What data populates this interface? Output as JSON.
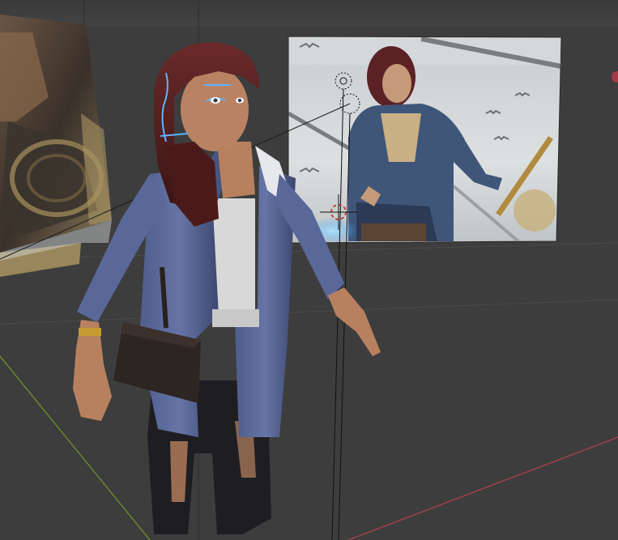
{
  "viewport": {
    "mode": "3D Viewport",
    "background": "#3d3d3d",
    "header_band": "#3a3a3a"
  },
  "axes": {
    "x_axis_color": "#a4404a",
    "y_axis_color": "#6e8a2f"
  },
  "objects": [
    {
      "name": "reference-image-left",
      "type": "image-plane",
      "selected": false
    },
    {
      "name": "reference-image-right",
      "type": "image-plane",
      "selected": false
    },
    {
      "name": "character-model",
      "type": "mesh",
      "selected": true
    },
    {
      "name": "hair-mesh",
      "type": "mesh",
      "selected": true
    },
    {
      "name": "satchel-bag",
      "type": "mesh",
      "selected": false
    },
    {
      "name": "light-gizmo",
      "type": "light",
      "selected": false
    },
    {
      "name": "3d-cursor",
      "type": "cursor",
      "selected": false
    }
  ],
  "colors": {
    "jacket": "#5e6d9c",
    "jacket_dark": "#3c4668",
    "skin": "#b7815f",
    "hair": "#5a1f22",
    "pants": "#1e1e22",
    "bag": "#2d2522",
    "selection_outline": "#5fb3ff"
  }
}
